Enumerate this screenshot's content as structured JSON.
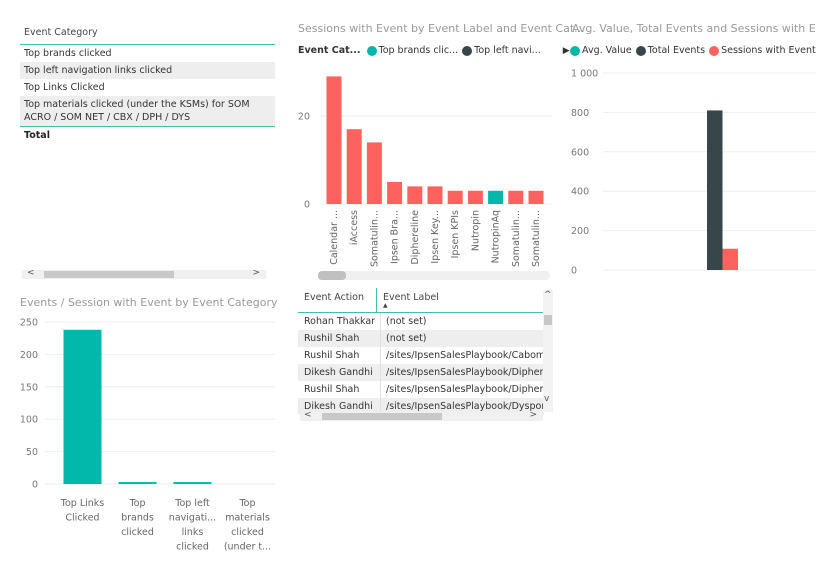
{
  "colors": {
    "teal": "#01B8AA",
    "dark": "#374649",
    "red": "#FD625E",
    "grid": "#eeeeee",
    "accent_line": "#3fbfb4"
  },
  "left_table": {
    "header": "Event Category",
    "rows": [
      "Top brands clicked",
      "Top left navigation links clicked",
      "Top Links Clicked",
      "Top materials clicked (under the KSMs) for SOM ACRO / SOM NET / CBX / DPH / DYS"
    ],
    "total_label": "Total",
    "scroll_left": "<",
    "scroll_right": ">"
  },
  "chart_data": [
    {
      "id": "events-per-session",
      "type": "bar",
      "title": "Events / Session with Event by Event Category",
      "categories": [
        "Top Links Clicked",
        "Top brands clicked",
        "Top left navigati... links clicked",
        "Top materials clicked (under t..."
      ],
      "category_lines": [
        [
          "Top Links",
          "Clicked"
        ],
        [
          "Top",
          "brands",
          "clicked"
        ],
        [
          "Top left",
          "navigati...",
          "links",
          "clicked"
        ],
        [
          "Top",
          "materials",
          "clicked",
          "(under t..."
        ]
      ],
      "values": [
        238,
        3,
        3,
        0
      ],
      "ylim": [
        0,
        250
      ],
      "yticks": [
        0,
        50,
        100,
        150,
        200,
        250
      ],
      "grid": true,
      "color": "#01B8AA"
    },
    {
      "id": "sessions-by-label",
      "type": "bar",
      "title": "Sessions with Event by Event Label and Event Cat...",
      "legend_title": "Event Cat...",
      "legend": [
        {
          "name": "Top brands clic...",
          "color": "#01B8AA"
        },
        {
          "name": "Top left navi...",
          "color": "#374649"
        }
      ],
      "legend_more": "▶",
      "categories": [
        "Calendar ...",
        "iAccess",
        "Somatulin...",
        "Ipsen Bra...",
        "Diphereline",
        "Ipsen Key...",
        "Ipsen KPIs",
        "Nutropin",
        "NutropinAq",
        "Somatulin...",
        "Somatulin..."
      ],
      "values": [
        29,
        17,
        14,
        5,
        4,
        4,
        3,
        3,
        3,
        3,
        3
      ],
      "bar_colors": [
        "#FD625E",
        "#FD625E",
        "#FD625E",
        "#FD625E",
        "#FD625E",
        "#FD625E",
        "#FD625E",
        "#FD625E",
        "#01B8AA",
        "#FD625E",
        "#FD625E"
      ],
      "ylim": [
        0,
        30
      ],
      "yticks": [
        0,
        20
      ],
      "grid": true
    },
    {
      "id": "avg-total-sessions",
      "type": "bar",
      "title": "Avg. Value, Total Events and Sessions with Event",
      "legend": [
        {
          "name": "Avg. Value",
          "color": "#01B8AA"
        },
        {
          "name": "Total Events",
          "color": "#374649"
        },
        {
          "name": "Sessions with Event",
          "color": "#FD625E"
        }
      ],
      "series": [
        {
          "name": "Avg. Value",
          "values": [
            0
          ]
        },
        {
          "name": "Total Events",
          "values": [
            810
          ]
        },
        {
          "name": "Sessions with Event",
          "values": [
            108
          ]
        }
      ],
      "yticks": [
        0,
        200,
        400,
        600,
        800,
        1000
      ],
      "ytick_labels": [
        "0",
        "200",
        "400",
        "600",
        "800",
        "1 000"
      ],
      "ylim": [
        0,
        1000
      ],
      "grid": true
    }
  ],
  "mid_table": {
    "columns": [
      "Event Action",
      "Event Label"
    ],
    "sort_indicator": "▲",
    "rows": [
      [
        "Rohan Thakkar",
        "(not set)"
      ],
      [
        "Rushil Shah",
        "(not set)"
      ],
      [
        "Rushil Shah",
        "/sites/IpsenSalesPlaybook/Cabomety"
      ],
      [
        "Dikesh Gandhi",
        "/sites/IpsenSalesPlaybook/Diphereline"
      ],
      [
        "Rushil Shah",
        "/sites/IpsenSalesPlaybook/Diphereline"
      ],
      [
        "Dikesh Gandhi",
        "/sites/IpsenSalesPlaybook/Dysport/P"
      ]
    ],
    "scroll_up": "^",
    "scroll_down": "v",
    "scroll_left": "<",
    "scroll_right": ">"
  }
}
